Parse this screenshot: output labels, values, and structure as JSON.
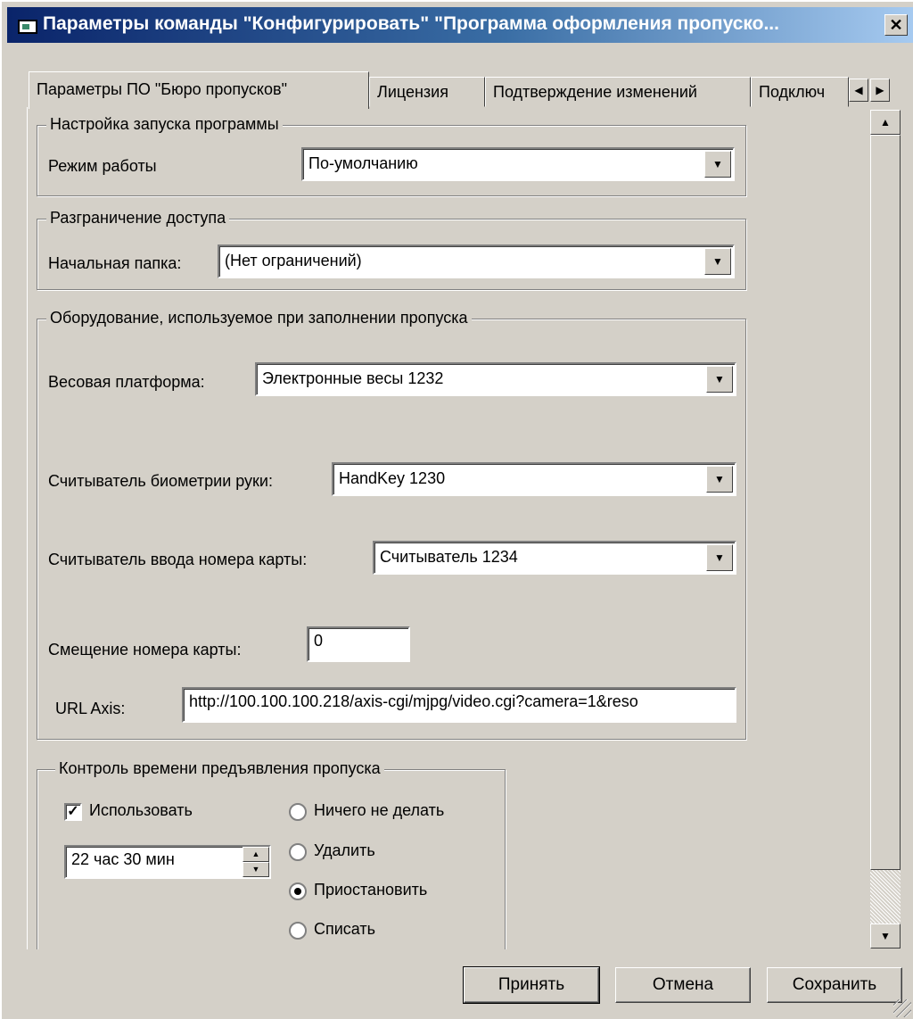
{
  "window": {
    "title": "Параметры команды \"Конфигурировать\" \"Программа оформления пропуско...",
    "close_glyph": "✕"
  },
  "tabs": [
    {
      "label": "Параметры ПО \"Бюро пропусков\"",
      "active": true
    },
    {
      "label": "Лицензия",
      "active": false
    },
    {
      "label": "Подтверждение изменений",
      "active": false
    },
    {
      "label": "Подключ",
      "active": false
    }
  ],
  "launch": {
    "legend": "Настройка запуска программы",
    "mode_label": "Режим работы",
    "mode_value": "По-умолчанию"
  },
  "access": {
    "legend": "Разграничение доступа",
    "folder_label": "Начальная папка:",
    "folder_value": "(Нет ограничений)"
  },
  "equipment": {
    "legend": "Оборудование, используемое при заполнении пропуска",
    "scale_label": "Весовая платформа:",
    "scale_value": "Электронные весы 1232",
    "biometric_label": "Считыватель биометрии руки:",
    "biometric_value": "HandKey 1230",
    "card_reader_label": "Считыватель ввода номера карты:",
    "card_reader_value": "Считыватель 1234",
    "offset_label": "Смещение номера карты:",
    "offset_value": "0",
    "url_label": "URL Axis:",
    "url_value": "http://100.100.100.218/axis-cgi/mjpg/video.cgi?camera=1&reso"
  },
  "time_control": {
    "legend": "Контроль времени предъявления пропуска",
    "use_label": "Использовать",
    "use_checked": true,
    "time_value": "22 час  30 мин",
    "options": [
      "Ничего не делать",
      "Удалить",
      "Приостановить",
      "Списать"
    ],
    "selected": "Приостановить"
  },
  "buttons": {
    "accept": "Принять",
    "cancel": "Отмена",
    "save": "Сохранить"
  }
}
